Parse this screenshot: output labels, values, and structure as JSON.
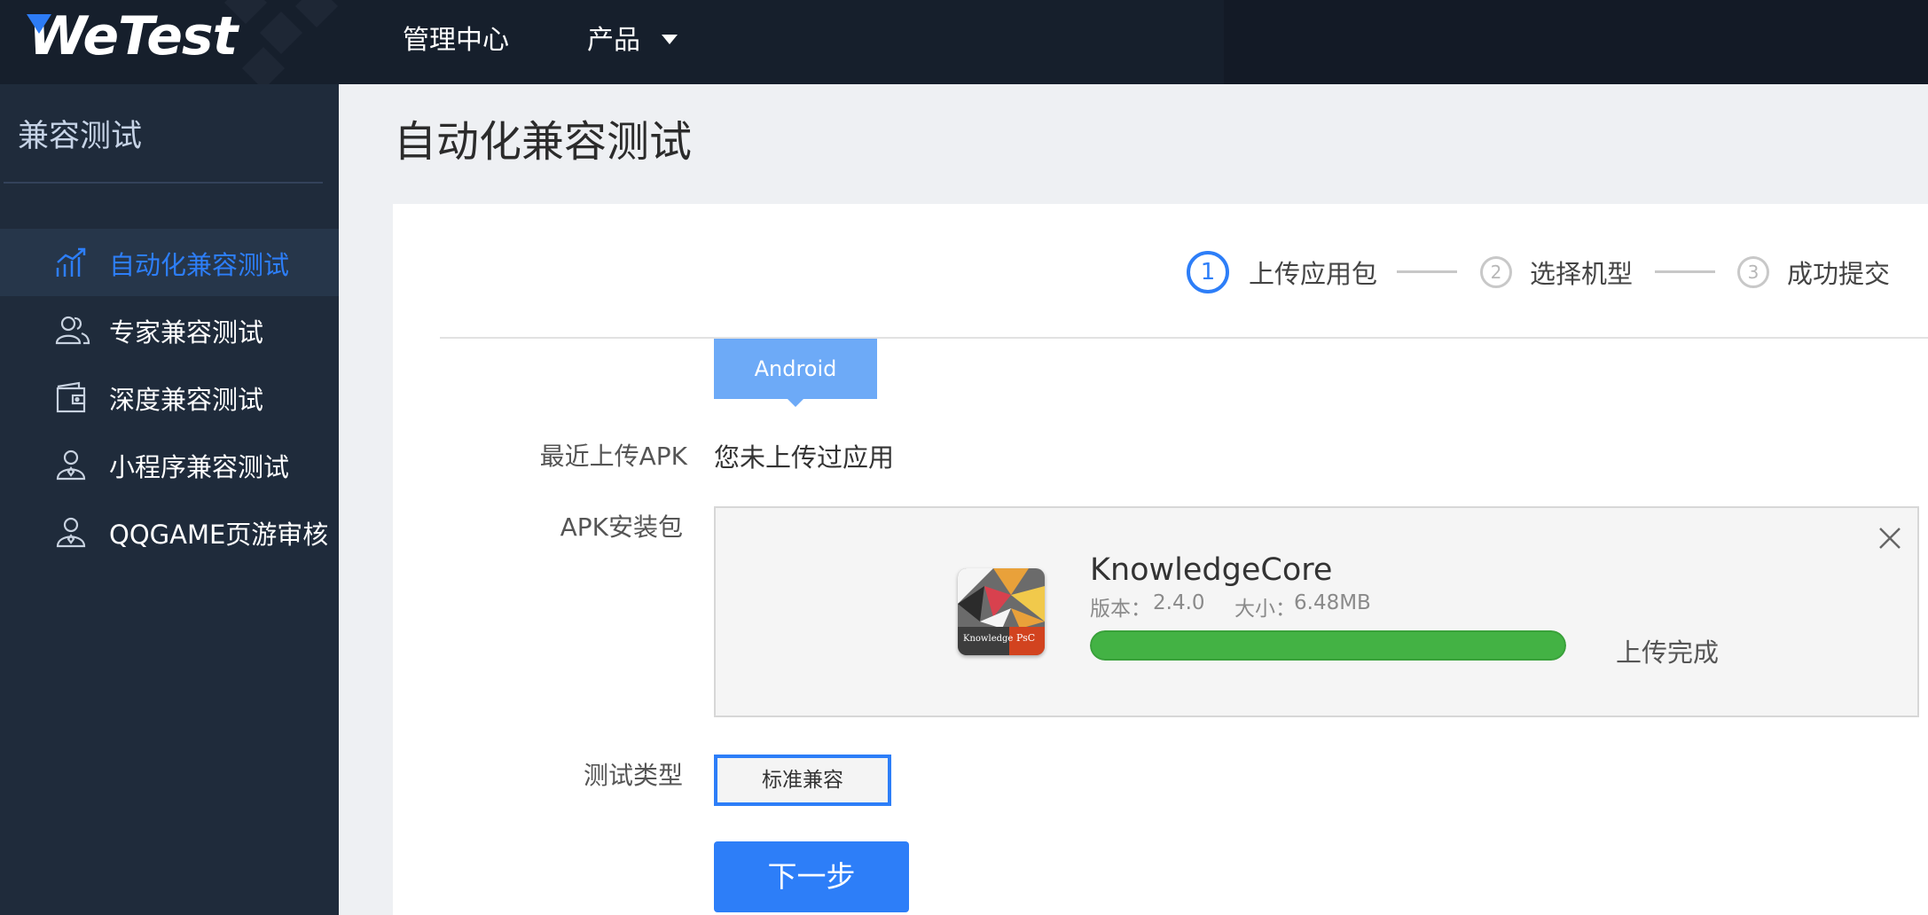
{
  "topbar": {
    "logo": "WeTest",
    "nav": [
      {
        "label": "管理中心"
      },
      {
        "label": "产品"
      }
    ]
  },
  "sidebar": {
    "title": "兼容测试",
    "items": [
      {
        "label": "自动化兼容测试",
        "icon": "chart-trend-icon",
        "active": true
      },
      {
        "label": "专家兼容测试",
        "icon": "users-icon"
      },
      {
        "label": "深度兼容测试",
        "icon": "wallet-icon"
      },
      {
        "label": "小程序兼容测试",
        "icon": "user-icon"
      },
      {
        "label": "QQGAME页游审核",
        "icon": "user-icon"
      }
    ]
  },
  "page": {
    "title": "自动化兼容测试"
  },
  "steps": [
    {
      "number": "1",
      "label": "上传应用包"
    },
    {
      "number": "2",
      "label": "选择机型"
    },
    {
      "number": "3",
      "label": "成功提交"
    }
  ],
  "form": {
    "os_tab": "Android",
    "recent_label": "最近上传APK",
    "recent_value": "您未上传过应用",
    "apk_label": "APK安装包",
    "test_type_label": "测试类型",
    "test_type_value": "标准兼容",
    "next_button": "下一步"
  },
  "upload": {
    "app_name": "KnowledgeCore",
    "version_label": "版本：",
    "version": "2.4.0",
    "size_label": "大小：",
    "size": "6.48MB",
    "progress": 1.0,
    "status": "上传完成"
  },
  "colors": {
    "accent": "#2d7ef8",
    "progress": "#43b244",
    "sidebar_bg": "#1f2b3b",
    "topbar_bg": "#131a26"
  }
}
